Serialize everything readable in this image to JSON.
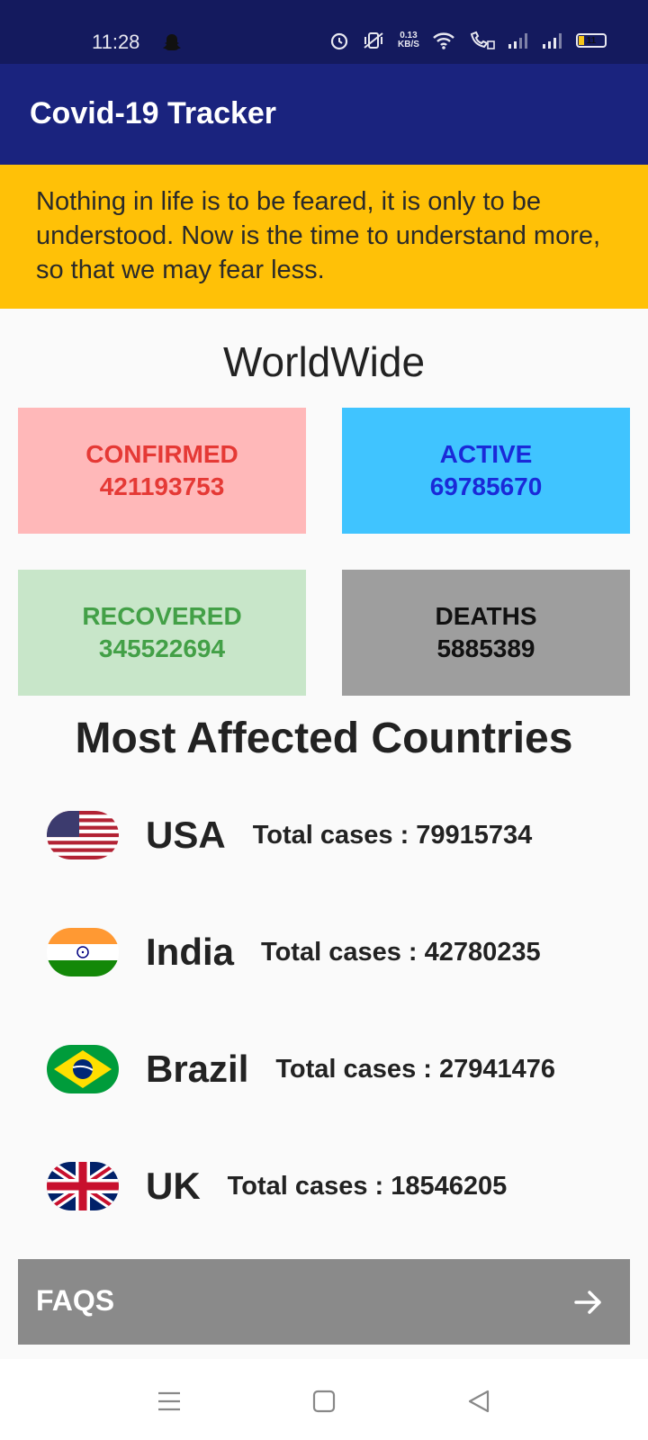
{
  "status_bar": {
    "time": "11:28",
    "net_speed_value": "0.13",
    "net_speed_unit": "KB/S",
    "battery": "11",
    "icons": [
      "snapchat-icon",
      "alarm-icon",
      "vibrate-icon",
      "wifi-icon",
      "wifi-calling-icon",
      "signal-icon",
      "signal-icon",
      "battery-icon"
    ]
  },
  "appbar": {
    "title": "Covid-19 Tracker"
  },
  "quote": {
    "text": "Nothing in life is to be feared, it is only to be understood. Now is the time to understand more, so that we may fear less."
  },
  "worldwide": {
    "title": "WorldWide",
    "confirmed": {
      "label": "CONFIRMED",
      "value": "421193753",
      "bg": "#ffb8b9",
      "fg": "#e53935"
    },
    "active": {
      "label": "ACTIVE",
      "value": "69785670",
      "bg": "#40c4ff",
      "fg": "#1a2ad8"
    },
    "recovered": {
      "label": "RECOVERED",
      "value": "345522694",
      "bg": "#c8e6c9",
      "fg": "#43a047"
    },
    "deaths": {
      "label": "DEATHS",
      "value": "5885389",
      "bg": "#9e9e9e",
      "fg": "#111111"
    }
  },
  "most_affected": {
    "title": "Most Affected Countries",
    "countries": [
      {
        "name": "USA",
        "cases": "Total cases : 79915734",
        "flag": "us-flag-icon"
      },
      {
        "name": "India",
        "cases": "Total cases : 42780235",
        "flag": "india-flag-icon"
      },
      {
        "name": "Brazil",
        "cases": "Total cases : 27941476",
        "flag": "brazil-flag-icon"
      },
      {
        "name": "UK",
        "cases": "Total cases : 18546205",
        "flag": "uk-flag-icon"
      }
    ]
  },
  "faqs": {
    "label": "FAQS",
    "icon": "arrow-right-icon"
  },
  "navbar": {
    "icons": [
      "menu-icon",
      "home-icon",
      "back-icon"
    ]
  },
  "colors": {
    "statusbar": "#141a5e",
    "appbar": "#1a237e",
    "quote_bg": "#ffc107",
    "faqs_bg": "#8a8a8a"
  }
}
